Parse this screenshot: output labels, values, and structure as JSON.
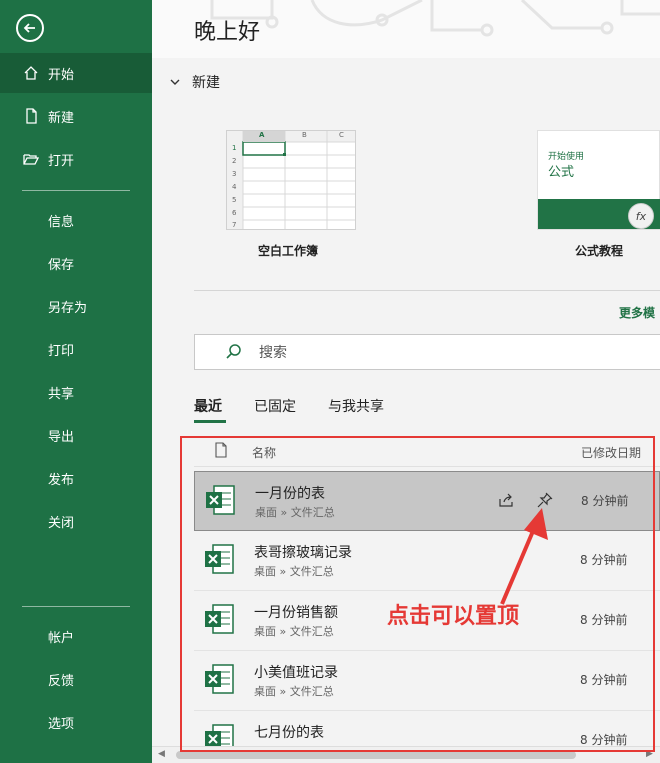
{
  "sidebar": {
    "back_label": "",
    "nav_top": [
      {
        "label": "开始",
        "icon": "home-icon",
        "active": true
      },
      {
        "label": "新建",
        "icon": "new-file-icon"
      },
      {
        "label": "打开",
        "icon": "open-folder-icon"
      }
    ],
    "nav_mid": [
      {
        "label": "信息"
      },
      {
        "label": "保存"
      },
      {
        "label": "另存为"
      },
      {
        "label": "打印"
      },
      {
        "label": "共享"
      },
      {
        "label": "导出"
      },
      {
        "label": "发布"
      },
      {
        "label": "关闭"
      }
    ],
    "nav_bottom": [
      {
        "label": "帐户"
      },
      {
        "label": "反馈"
      },
      {
        "label": "选项"
      }
    ]
  },
  "main": {
    "greeting": "晚上好",
    "new_section": {
      "title": "新建",
      "templates": [
        {
          "label": "空白工作簿",
          "col_headers": [
            "A",
            "B",
            "C"
          ],
          "row_numbers": [
            "1",
            "2",
            "3",
            "4",
            "5",
            "6",
            "7"
          ]
        },
        {
          "label": "公式教程",
          "small_text": "开始使用",
          "big_text": "公式",
          "fx": "fx"
        }
      ],
      "more_link": "更多模"
    },
    "search": {
      "placeholder": "搜索"
    },
    "tabs": [
      {
        "label": "最近",
        "active": true
      },
      {
        "label": "已固定"
      },
      {
        "label": "与我共享"
      }
    ],
    "columns": {
      "name": "名称",
      "modified": "已修改日期"
    },
    "files": [
      {
        "name": "一月份的表",
        "path": "桌面 » 文件汇总",
        "modified": "8 分钟前",
        "selected": true
      },
      {
        "name": "表哥擦玻璃记录",
        "path": "桌面 » 文件汇总",
        "modified": "8 分钟前"
      },
      {
        "name": "一月份销售额",
        "path": "桌面 » 文件汇总",
        "modified": "8 分钟前"
      },
      {
        "name": "小美值班记录",
        "path": "桌面 » 文件汇总",
        "modified": "8 分钟前"
      },
      {
        "name": "七月份的表",
        "path": "",
        "modified": "8 分钟前"
      }
    ]
  },
  "annotation": {
    "text": "点击可以置顶",
    "color": "#e53935"
  },
  "colors": {
    "sidebar": "#1e7145",
    "sidebar_active": "#185c37",
    "accent": "#217346"
  }
}
